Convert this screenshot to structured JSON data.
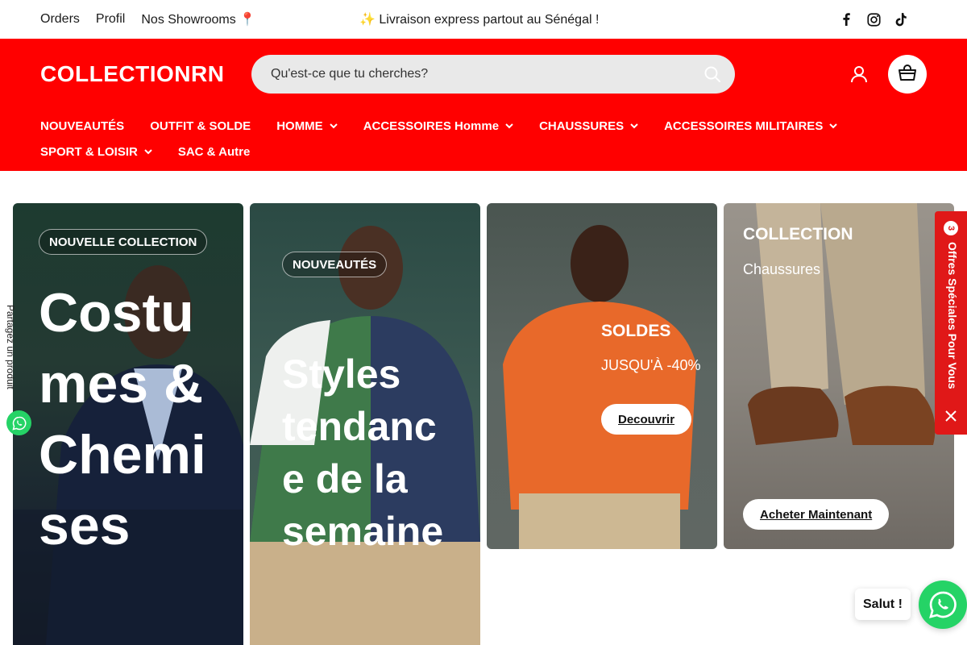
{
  "topbar": {
    "links": [
      "Orders",
      "Profil",
      "Nos Showrooms 📍"
    ],
    "announcement": "✨ Livraison express partout au Sénégal !",
    "social_icons": [
      "facebook-icon",
      "instagram-icon",
      "tiktok-icon"
    ]
  },
  "header": {
    "logo": "COLLECTIONRN",
    "search_placeholder": "Qu'est-ce que tu cherches?",
    "background_color": "#ff0000"
  },
  "nav": {
    "row1": [
      {
        "label": "NOUVEAUTÉS",
        "has_dropdown": false
      },
      {
        "label": "OUTFIT & SOLDE",
        "has_dropdown": false
      },
      {
        "label": "HOMME",
        "has_dropdown": true
      },
      {
        "label": "ACCESSOIRES Homme",
        "has_dropdown": true
      },
      {
        "label": "CHAUSSURES",
        "has_dropdown": true
      },
      {
        "label": "ACCESSOIRES MILITAIRES",
        "has_dropdown": true
      }
    ],
    "row2": [
      {
        "label": "SPORT & LOISIR",
        "has_dropdown": true
      },
      {
        "label": "SAC & Autre",
        "has_dropdown": false
      }
    ]
  },
  "cards": {
    "card1": {
      "tag": "NOUVELLE COLLECTION",
      "title_lines": [
        "Costu",
        "mes &",
        "Chemi",
        "ses"
      ]
    },
    "card2": {
      "tag": "NOUVEAUTÉS",
      "title_lines": [
        "Styles",
        "tendanc",
        "e de la",
        "semaine"
      ]
    },
    "card3": {
      "title": "SOLDES",
      "subtitle": "JUSQU'À -40%",
      "button": "Decouvrir"
    },
    "card4": {
      "title": "COLLECTION",
      "subtitle": "Chaussures",
      "button": "Acheter Maintenant"
    }
  },
  "side": {
    "share_label": "Partagez un produit",
    "offers_count": "3",
    "offers_label": "Offres Spéciales Pour Vous",
    "chat_greeting": "Salut !"
  }
}
